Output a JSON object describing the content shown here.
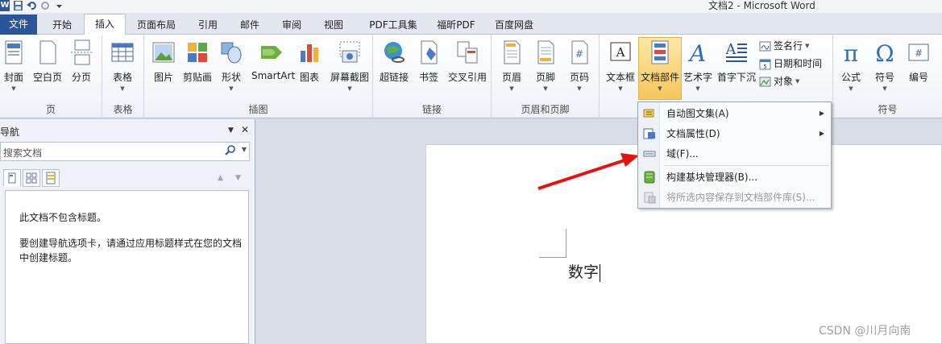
{
  "window": {
    "title": "文档2 - Microsoft Word"
  },
  "tabs": [
    "文件",
    "开始",
    "插入",
    "页面布局",
    "引用",
    "邮件",
    "审阅",
    "视图",
    "PDF工具集",
    "福昕PDF",
    "百度网盘"
  ],
  "active_tab": "插入",
  "ribbon": {
    "groups": {
      "page": "页",
      "table": "表格",
      "illustration": "插图",
      "link": "链接",
      "header_footer": "页眉和页脚",
      "symbol": "符号"
    },
    "buttons": {
      "cover": "封面",
      "blank_page": "空白页",
      "page_break": "分页",
      "table": "表格",
      "picture": "图片",
      "clip_art": "剪贴画",
      "shapes": "形状",
      "smartart": "SmartArt",
      "chart": "图表",
      "screenshot": "屏幕截图",
      "hyperlink": "超链接",
      "bookmark": "书签",
      "cross_ref": "交叉引用",
      "header": "页眉",
      "footer": "页脚",
      "page_number": "页码",
      "textbox": "文本框",
      "quick_parts": "文档部件",
      "wordart": "艺术字",
      "dropcap": "首字下沉",
      "signature_line": "签名行",
      "date_time": "日期和时间",
      "object": "对象",
      "equation": "公式",
      "symbol": "符号",
      "number": "编号"
    }
  },
  "dropdown": {
    "items": [
      {
        "label": "自动图文集(A)",
        "submenu": true,
        "disabled": false
      },
      {
        "label": "文档属性(D)",
        "submenu": true,
        "disabled": false
      },
      {
        "label": "域(F)...",
        "submenu": false,
        "disabled": false
      },
      {
        "label": "构建基块管理器(B)...",
        "submenu": false,
        "disabled": false
      },
      {
        "label": "将所选内容保存到文档部件库(S)...",
        "submenu": false,
        "disabled": true
      }
    ]
  },
  "nav": {
    "title": "导航",
    "search_placeholder": "搜索文档",
    "no_headings": "此文档不包含标题。",
    "hint": "要创建导航选项卡，请通过应用标题样式在您的文档中创建标题。"
  },
  "document": {
    "text": "数字"
  },
  "watermark": "CSDN @川月向南",
  "colors": {
    "file_tab": "#2a5699",
    "highlight": "#f6c65b",
    "arrow": "#e3140f"
  }
}
